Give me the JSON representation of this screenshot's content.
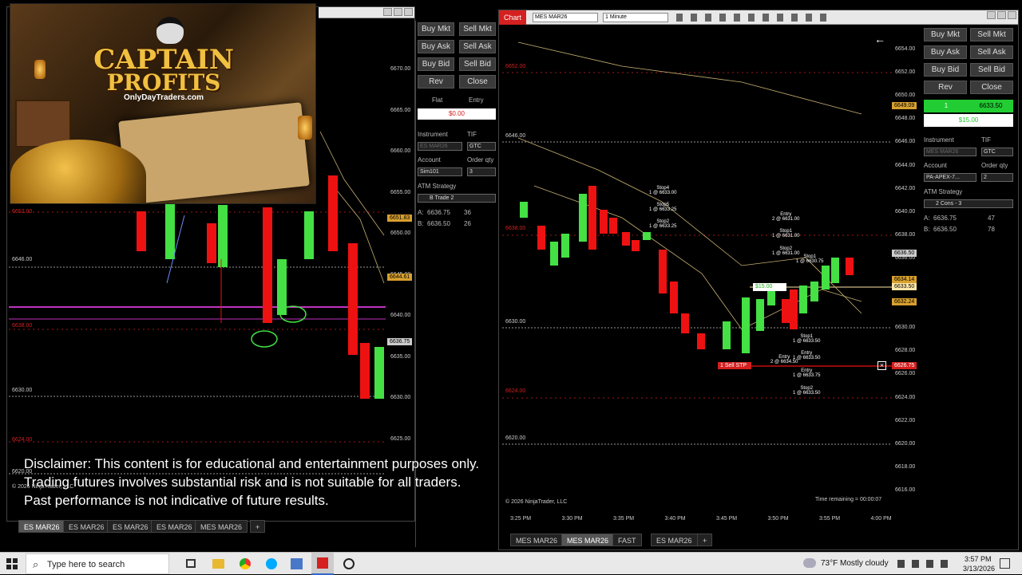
{
  "colors": {
    "up": "#44e044",
    "down": "#ee1111",
    "accent_red": "#d42020",
    "green_entry": "#22cc33",
    "gold": "#d8a02e",
    "magenta": "#ff44ff"
  },
  "logo": {
    "line1": "CAPTAIN",
    "line2": "PROFITS",
    "site": "OnlyDayTraders.com"
  },
  "left_chart": {
    "price_ticks": [
      "6670.00",
      "6665.00",
      "6660.00",
      "6655.00",
      "6650.00",
      "6645.00",
      "6640.00",
      "6635.00",
      "6630.00",
      "6625.00"
    ],
    "level_labels": {
      "l6646": "6646.00",
      "l6652": "6652.00",
      "l6638": "6638.00",
      "l6630": "6630.00",
      "l6624": "6624.00",
      "l6620": "6620.00"
    },
    "flags": {
      "f1": "6651.83",
      "f2": "6644.61",
      "f3": "6636.75"
    },
    "copyright": "© 2026 NinjaTrader, LLC",
    "tabs": [
      "ES MAR26",
      "ES MAR26",
      "ES MAR26",
      "ES MAR26",
      "MES MAR26"
    ],
    "add_tab": "+"
  },
  "left_order": {
    "buy_mkt": "Buy Mkt",
    "sell_mkt": "Sell Mkt",
    "buy_ask": "Buy Ask",
    "sell_ask": "Sell Ask",
    "buy_bid": "Buy Bid",
    "sell_bid": "Sell Bid",
    "rev": "Rev",
    "close": "Close",
    "pos_flat": "Flat",
    "pos_entry": "Entry",
    "pnl": "$0.00",
    "instrument_lbl": "Instrument",
    "tif_lbl": "TIF",
    "instrument": "ES MAR26",
    "tif": "GTC",
    "account_lbl": "Account",
    "qty_lbl": "Order qty",
    "account": "Sim101",
    "qty": "3",
    "atm_lbl": "ATM Strategy",
    "atm": "B Trade 2",
    "ask_lbl": "A:",
    "ask": "6636.75",
    "ask_sz": "36",
    "bid_lbl": "B:",
    "bid": "6636.50",
    "bid_sz": "26"
  },
  "right_chart": {
    "tab_label": "Chart",
    "instrument": "MES MAR26",
    "interval": "1 Minute",
    "price_ticks": [
      "6654.00",
      "6652.00",
      "6650.00",
      "6648.00",
      "6646.00",
      "6644.00",
      "6642.00",
      "6640.00",
      "6638.00",
      "6636.00",
      "6634.00",
      "6632.00",
      "6630.00",
      "6628.00",
      "6626.00",
      "6624.00",
      "6622.00",
      "6620.00",
      "6618.00",
      "6616.00"
    ],
    "level_labels": {
      "l6652": "6652.00",
      "l6646": "6646.00",
      "l6638": "6638.00",
      "l6630": "6630.00",
      "l6624": "6624.00",
      "l6620": "6620.00"
    },
    "time_ticks": [
      "3:25 PM",
      "3:30 PM",
      "3:35 PM",
      "3:40 PM",
      "3:45 PM",
      "3:50 PM",
      "3:55 PM",
      "4:00 PM"
    ],
    "flags": {
      "f1": "6649.09",
      "f2": "6636.50",
      "f3": "6634.14",
      "f4": "6633.50",
      "f5": "6632.24",
      "f6": "6626.75"
    },
    "sell_stp": "1 Sell STP",
    "tp_tag": "$15.00",
    "annos": {
      "stop4": "Stop4",
      "stop4v": "1 @ 6633.00",
      "stop5": "Stop5",
      "stop5v": "1 @ 6633.25",
      "stop2": "Stop2",
      "stop2v": "1 @ 6633.25",
      "entry_a": "Entry",
      "entry_av": "2 @ 6631.00",
      "stop1_a": "Stop1",
      "stop1_av": "1 @ 6631.00",
      "stop2_a": "Stop2",
      "stop2_av": "1 @ 6631.00",
      "stop1_b": "Stop1",
      "stop1_bv": "1 @ 6630.75",
      "stop1_c": "Stop1",
      "stop1_cv": "1 @ 6633.50",
      "entry_c": "Entry",
      "entry_cv": "1 @ 6633.50",
      "entry_d": "Entry",
      "entry_dv": "2 @ 6634.50",
      "entry_e": "Entry",
      "entry_ev": "1 @ 6633.75",
      "stop2_e": "Stop2",
      "stop2_ev": "1 @ 6633.50"
    },
    "time_remaining": "Time remaining = 00:00:07",
    "copyright": "© 2026 NinjaTrader, LLC",
    "tabs": [
      "MES MAR26",
      "MES MAR26",
      "FAST",
      "ES MAR26"
    ],
    "add_tab": "+"
  },
  "right_order": {
    "buy_mkt": "Buy Mkt",
    "sell_mkt": "Sell Mkt",
    "buy_ask": "Buy Ask",
    "sell_ask": "Sell Ask",
    "buy_bid": "Buy Bid",
    "sell_bid": "Sell Bid",
    "rev": "Rev",
    "close": "Close",
    "pos_qty": "1",
    "pos_price": "6633.50",
    "pnl": "$15.00",
    "instrument_lbl": "Instrument",
    "tif_lbl": "TIF",
    "instrument": "MES MAR26",
    "tif": "GTC",
    "account_lbl": "Account",
    "qty_lbl": "Order qty",
    "account": "PA-APEX-7...",
    "qty": "2",
    "atm_lbl": "ATM Strategy",
    "atm": "2 Cons - 3",
    "ask_lbl": "A:",
    "ask": "6636.75",
    "ask_sz": "47",
    "bid_lbl": "B:",
    "bid": "6636.50",
    "bid_sz": "78"
  },
  "disclaimer": {
    "line1": "Disclaimer: This content is for educational and entertainment purposes only.",
    "line2": "Trading futures involves substantial risk and is not suitable for all traders.",
    "line3": "Past performance is not indicative of future results."
  },
  "taskbar": {
    "search_placeholder": "Type here to search",
    "weather": "73°F  Mostly cloudy",
    "time": "3:57 PM",
    "date": "3/13/2026"
  }
}
